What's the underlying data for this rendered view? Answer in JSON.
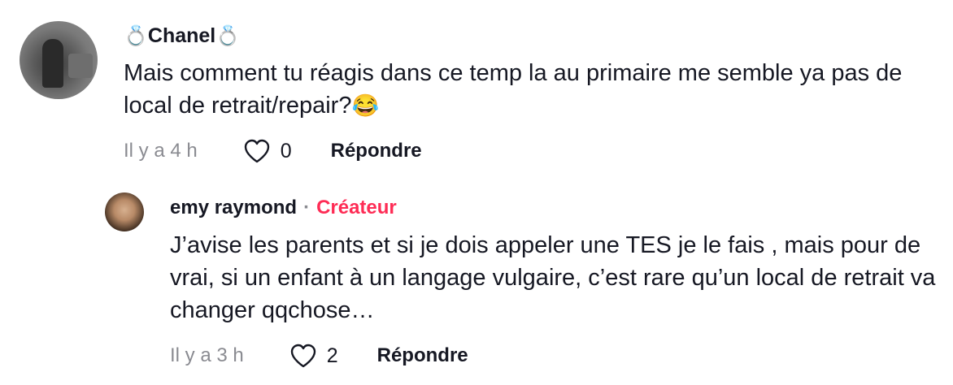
{
  "comment": {
    "username_prefix": "💍",
    "username": "Chanel",
    "username_suffix": "💍",
    "text": "Mais comment tu réagis dans ce temp la au primaire me semble ya pas de local de retrait/repair?",
    "emoji": "😂",
    "timestamp": "Il y a 4 h",
    "likes": "0",
    "reply_label": "Répondre"
  },
  "reply": {
    "username": "emy raymond",
    "separator": "·",
    "badge": "Créateur",
    "badge_color": "#fe2c55",
    "text": "J’avise les parents et si je dois appeler une TES je le fais , mais pour de vrai, si un enfant à un langage vulgaire, c’est rare qu’un local de retrait va changer qqchose…",
    "timestamp": "Il y a 3 h",
    "likes": "2",
    "reply_label": "Répondre"
  },
  "icons": {
    "like": "heart-outline-icon"
  }
}
